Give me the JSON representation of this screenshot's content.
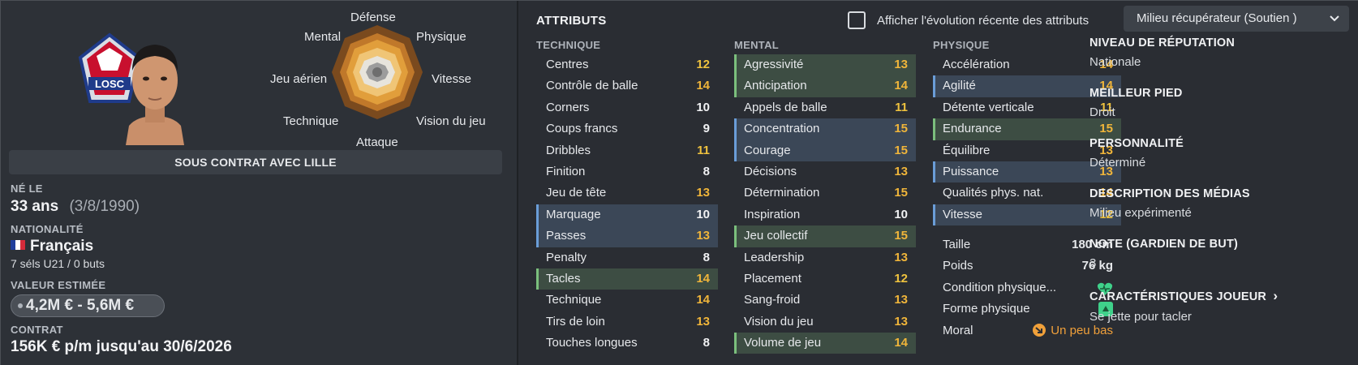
{
  "profile": {
    "radar_labels": {
      "top": "Défense",
      "top_right": "Physique",
      "right": "Vitesse",
      "bottom_right": "Vision du jeu",
      "bottom": "Attaque",
      "bottom_left": "Technique",
      "left": "Jeu aérien",
      "top_left": "Mental"
    },
    "contract_banner": "SOUS CONTRAT AVEC LILLE",
    "born_label": "NÉ LE",
    "age": "33 ans",
    "birth_date": "(3/8/1990)",
    "nationality_label": "NATIONALITÉ",
    "nationality": "Français",
    "caps": "7 séls U21 / 0 buts",
    "value_label": "VALEUR ESTIMÉE",
    "value": "4,2M € - 5,6M €",
    "contract_label": "CONTRAT",
    "contract": "156K € p/m jusqu'au 30/6/2026",
    "logo_text": "LOSC"
  },
  "attributes": {
    "title": "ATTRIBUTS",
    "toggle_label": "Afficher l'évolution récente des attributs",
    "role": "Milieu récupérateur (Soutien )",
    "technique_label": "TECHNIQUE",
    "mental_label": "MENTAL",
    "physique_label": "PHYSIQUE",
    "technique": [
      {
        "name": "Centres",
        "value": "12",
        "hl": ""
      },
      {
        "name": "Contrôle de balle",
        "value": "14",
        "hl": ""
      },
      {
        "name": "Corners",
        "value": "10",
        "hl": ""
      },
      {
        "name": "Coups francs",
        "value": "9",
        "hl": ""
      },
      {
        "name": "Dribbles",
        "value": "11",
        "hl": ""
      },
      {
        "name": "Finition",
        "value": "8",
        "hl": ""
      },
      {
        "name": "Jeu de tête",
        "value": "13",
        "hl": ""
      },
      {
        "name": "Marquage",
        "value": "10",
        "hl": "b"
      },
      {
        "name": "Passes",
        "value": "13",
        "hl": "b"
      },
      {
        "name": "Penalty",
        "value": "8",
        "hl": ""
      },
      {
        "name": "Tacles",
        "value": "14",
        "hl": "g"
      },
      {
        "name": "Technique",
        "value": "14",
        "hl": ""
      },
      {
        "name": "Tirs de loin",
        "value": "13",
        "hl": ""
      },
      {
        "name": "Touches longues",
        "value": "8",
        "hl": ""
      }
    ],
    "mental": [
      {
        "name": "Agressivité",
        "value": "13",
        "hl": "g"
      },
      {
        "name": "Anticipation",
        "value": "14",
        "hl": "g"
      },
      {
        "name": "Appels de balle",
        "value": "11",
        "hl": ""
      },
      {
        "name": "Concentration",
        "value": "15",
        "hl": "b"
      },
      {
        "name": "Courage",
        "value": "15",
        "hl": "b"
      },
      {
        "name": "Décisions",
        "value": "13",
        "hl": ""
      },
      {
        "name": "Détermination",
        "value": "15",
        "hl": ""
      },
      {
        "name": "Inspiration",
        "value": "10",
        "hl": ""
      },
      {
        "name": "Jeu collectif",
        "value": "15",
        "hl": "g"
      },
      {
        "name": "Leadership",
        "value": "13",
        "hl": ""
      },
      {
        "name": "Placement",
        "value": "12",
        "hl": ""
      },
      {
        "name": "Sang-froid",
        "value": "13",
        "hl": ""
      },
      {
        "name": "Vision du jeu",
        "value": "13",
        "hl": ""
      },
      {
        "name": "Volume de jeu",
        "value": "14",
        "hl": "g"
      }
    ],
    "physique": [
      {
        "name": "Accélération",
        "value": "14",
        "hl": ""
      },
      {
        "name": "Agilité",
        "value": "14",
        "hl": "b"
      },
      {
        "name": "Détente verticale",
        "value": "11",
        "hl": ""
      },
      {
        "name": "Endurance",
        "value": "15",
        "hl": "g"
      },
      {
        "name": "Équilibre",
        "value": "13",
        "hl": ""
      },
      {
        "name": "Puissance",
        "value": "13",
        "hl": "b"
      },
      {
        "name": "Qualités phys. nat.",
        "value": "14",
        "hl": ""
      },
      {
        "name": "Vitesse",
        "value": "12",
        "hl": "b"
      }
    ],
    "extras": {
      "height_label": "Taille",
      "height": "180 cm",
      "weight_label": "Poids",
      "weight": "76 kg",
      "condition_label": "Condition physique...",
      "form_label": "Forme physique",
      "morale_label": "Moral",
      "morale": "Un peu bas"
    }
  },
  "info": {
    "reputation_label": "NIVEAU DE RÉPUTATION",
    "reputation": "Nationale",
    "foot_label": "MEILLEUR PIED",
    "foot": "Droit",
    "personality_label": "PERSONNALITÉ",
    "personality": "Déterminé",
    "media_label": "DESCRIPTION DES MÉDIAS",
    "media": "Milieu expérimenté",
    "gk_label": "NOTE (GARDIEN DE BUT)",
    "gk": "3",
    "traits_label": "CARACTÉRISTIQUES JOUEUR",
    "traits_chev": "›",
    "traits": "Se jette pour tacler"
  },
  "colors": {
    "value_high": "#f0b53a",
    "value_mid": "#efc23e",
    "highlight_green": "#7bbf7d",
    "highlight_blue": "#6a9dd8",
    "heart_green": "#3fd18a",
    "morale_orange": "#f0a03a"
  },
  "icons": {
    "condition": "heart-icon",
    "form": "form-square-icon",
    "morale": "arrow-down-right-icon",
    "dropdown": "chevron-down-icon",
    "nationality": "france-flag-icon"
  }
}
